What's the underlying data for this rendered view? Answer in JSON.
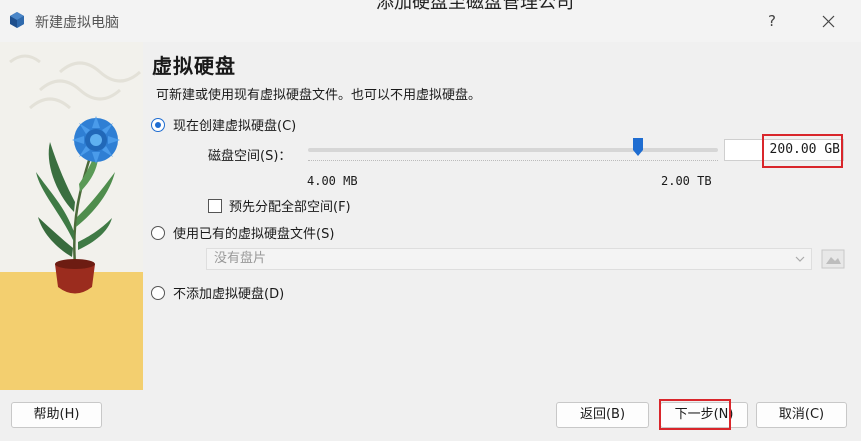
{
  "window": {
    "title": "新建虚拟电脑",
    "help_glyph": "?",
    "background_window_text": "添加硬盘至磁盘管理公司"
  },
  "page": {
    "heading": "虚拟硬盘",
    "description": "可新建或使用现有虚拟硬盘文件。也可以不用虚拟硬盘。"
  },
  "options": {
    "create_new": {
      "label": "现在创建虚拟硬盘(C)",
      "selected": true
    },
    "use_existing": {
      "label": "使用已有的虚拟硬盘文件(S)",
      "selected": false
    },
    "no_disk": {
      "label": "不添加虚拟硬盘(D)",
      "selected": false
    }
  },
  "disk_size": {
    "label": "磁盘空间(S)：",
    "value": "200.00 GB",
    "min_label": "4.00 MB",
    "max_label": "2.00 TB",
    "slider_fraction": 0.81
  },
  "preallocate": {
    "label": "预先分配全部空间(F)",
    "checked": false
  },
  "existing_disk": {
    "selected": "没有盘片"
  },
  "buttons": {
    "help": "帮助(H)",
    "back": "返回(B)",
    "next": "下一步(N)",
    "cancel": "取消(C)"
  },
  "colors": {
    "accent": "#1f6dd1",
    "highlight_box": "#d9262b",
    "illustration_bg": "#f2f1ec",
    "illustration_floor": "#f3cf6f"
  },
  "icons": {
    "app": "virtualbox-cube-icon",
    "close": "close-icon",
    "dropdown": "chevron-down-icon",
    "browse": "folder-icon"
  }
}
